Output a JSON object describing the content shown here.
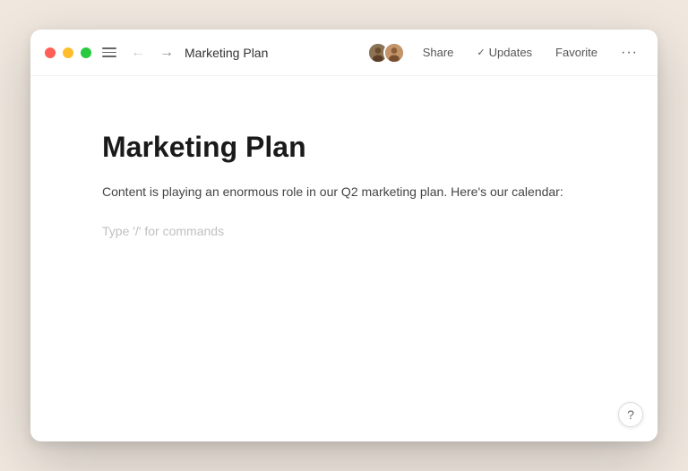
{
  "window": {
    "title": "Marketing Plan"
  },
  "titlebar": {
    "traffic_lights": {
      "close_color": "#ff5f56",
      "minimize_color": "#ffbd2e",
      "maximize_color": "#27c93f"
    },
    "actions": {
      "share_label": "Share",
      "updates_label": "Updates",
      "favorite_label": "Favorite",
      "more_symbol": "···"
    }
  },
  "document": {
    "title": "Marketing Plan",
    "body": "Content is playing an enormous role in our Q2 marketing plan. Here's our calendar:",
    "type_hint": "Type '/' for commands"
  },
  "help": {
    "symbol": "?"
  }
}
